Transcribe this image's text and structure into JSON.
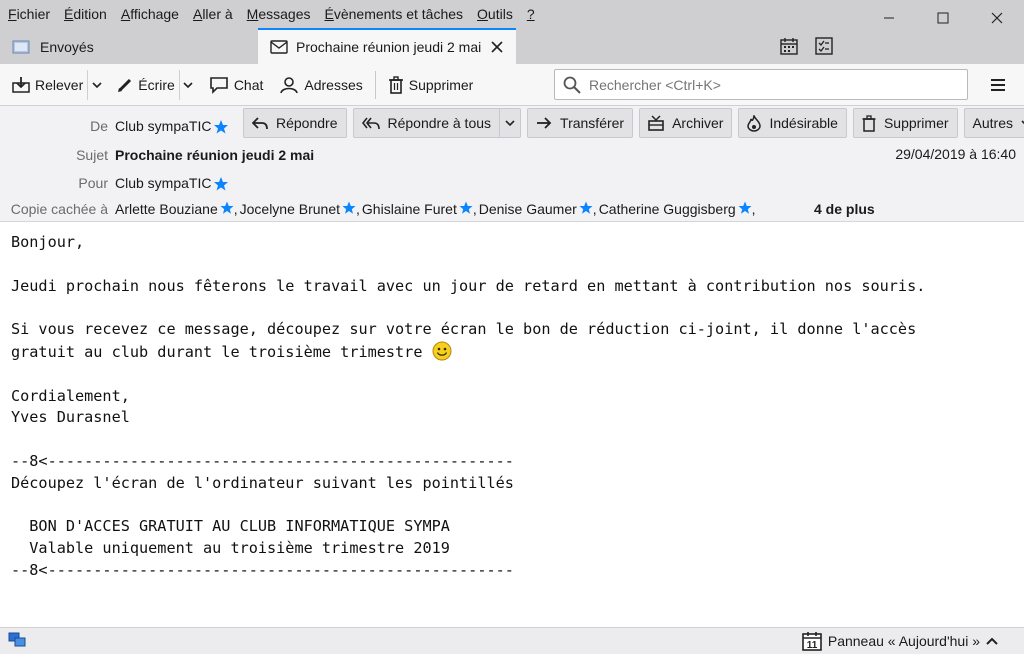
{
  "menu": [
    {
      "first": "F",
      "rest": "ichier"
    },
    {
      "first": "É",
      "rest": "dition"
    },
    {
      "first": "A",
      "rest": "ffichage"
    },
    {
      "first": "A",
      "rest": "ller à"
    },
    {
      "first": "M",
      "rest": "essages"
    },
    {
      "first": "É",
      "rest": "vènements et tâches"
    },
    {
      "first": "O",
      "rest": "utils"
    },
    {
      "first": "?",
      "rest": ""
    }
  ],
  "tabs": {
    "inactive_label": "Envoyés",
    "active_label": "Prochaine réunion jeudi 2 mai"
  },
  "toolbar": {
    "relever": "Relever",
    "ecrire": "Écrire",
    "chat": "Chat",
    "adresses": "Adresses",
    "supprimer": "Supprimer",
    "search_placeholder": "Rechercher <Ctrl+K>"
  },
  "header": {
    "from_label": "De",
    "from_value": "Club sympaTIC",
    "subject_label": "Sujet",
    "subject_value": "Prochaine réunion jeudi 2 mai",
    "date": "29/04/2019 à 16:40",
    "to_label": "Pour",
    "to_value": "Club sympaTIC",
    "bcc_label": "Copie cachée à",
    "bcc": [
      "Arlette Bouziane",
      "Jocelyne Brunet",
      "Ghislaine Furet",
      "Denise Gaumer",
      "Catherine Guggisberg"
    ],
    "bcc_more": "4 de plus",
    "star_color": "#0a84ff"
  },
  "actions": {
    "repondre": "Répondre",
    "repondre_tous": "Répondre à tous",
    "transferer": "Transférer",
    "archiver": "Archiver",
    "indesirable": "Indésirable",
    "supprimer": "Supprimer",
    "autres": "Autres"
  },
  "body": {
    "l1": "Bonjour,",
    "l2": "Jeudi prochain nous fêterons le travail avec un jour de retard en mettant à contribution nos souris.",
    "l3": "Si vous recevez ce message, découpez sur votre écran le bon de réduction ci-joint, il donne l'accès",
    "l4": "gratuit au club durant le troisième trimestre ",
    "l5": "Cordialement,",
    "l6": "Yves Durasnel",
    "l7": "--8<---------------------------------------------------",
    "l8": "Découpez l'écran de l'ordinateur suivant les pointillés",
    "l9": "  BON D'ACCES GRATUIT AU CLUB INFORMATIQUE SYMPA",
    "l10": "  Valable uniquement au troisième trimestre 2019",
    "l11": "--8<---------------------------------------------------"
  },
  "status": {
    "panel_label": "Panneau « Aujourd'hui »",
    "calendar_day": "11"
  }
}
